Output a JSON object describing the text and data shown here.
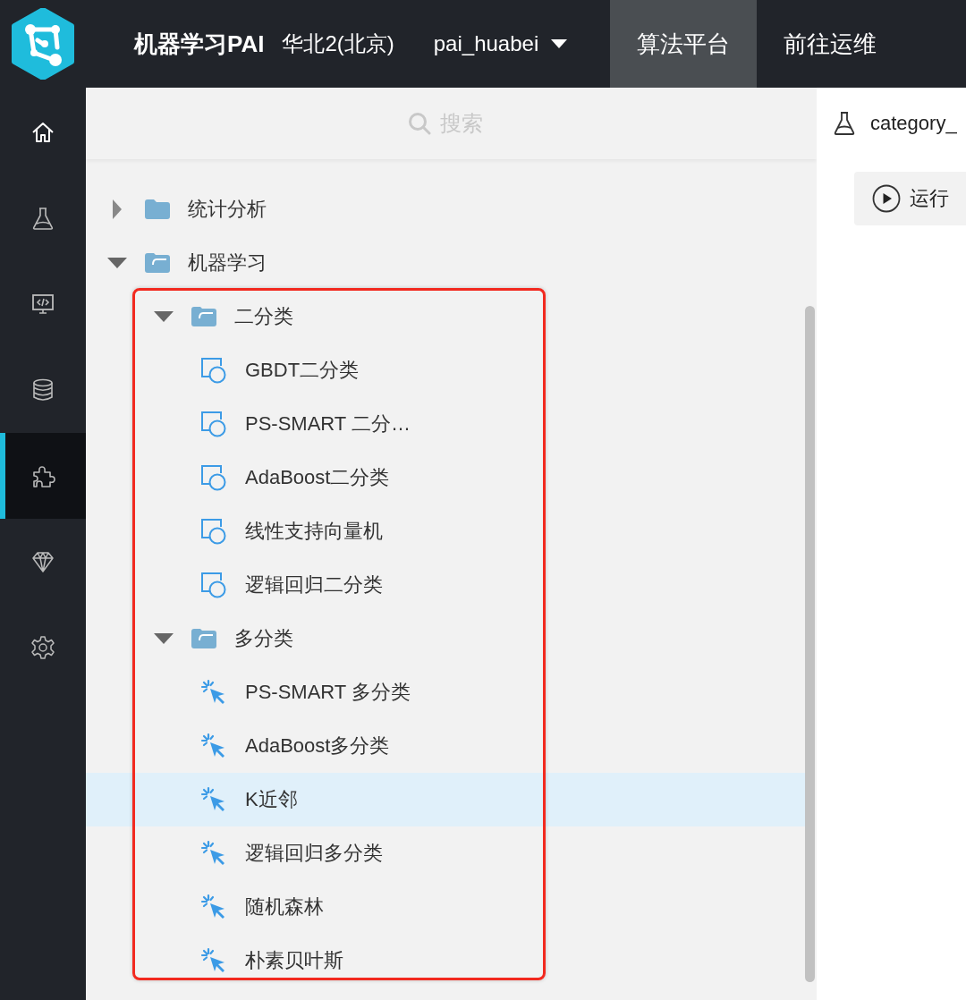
{
  "header": {
    "title": "机器学习PAI",
    "region": "华北2(北京)",
    "workspace": "pai_huabei",
    "nav": [
      {
        "label": "算法平台",
        "selected": true
      },
      {
        "label": "前往运维",
        "selected": false
      }
    ]
  },
  "sidebar": {
    "items": [
      {
        "kind": "home",
        "selected": false
      },
      {
        "kind": "flask",
        "selected": false
      },
      {
        "kind": "monitor",
        "selected": false
      },
      {
        "kind": "database",
        "selected": false
      },
      {
        "kind": "puzzle",
        "selected": true
      },
      {
        "kind": "diamond",
        "selected": false
      },
      {
        "kind": "settings",
        "selected": false
      }
    ]
  },
  "tree": {
    "search": {
      "placeholder": "搜索"
    },
    "items": [
      {
        "label": "统计分析",
        "kind": "folder",
        "expanded": false,
        "selected": false
      },
      {
        "label": "机器学习",
        "kind": "folder",
        "expanded": true,
        "selected": false,
        "children": [
          {
            "label": "二分类",
            "kind": "folder",
            "expanded": true,
            "selected": false,
            "children": [
              {
                "label": "GBDT二分类",
                "kind": "binary",
                "selected": false
              },
              {
                "label": "PS-SMART 二分…",
                "kind": "binary",
                "selected": false
              },
              {
                "label": "AdaBoost二分类",
                "kind": "binary",
                "selected": false
              },
              {
                "label": "线性支持向量机",
                "kind": "binary",
                "selected": false
              },
              {
                "label": "逻辑回归二分类",
                "kind": "binary",
                "selected": false
              }
            ]
          },
          {
            "label": "多分类",
            "kind": "folder",
            "expanded": true,
            "selected": false,
            "children": [
              {
                "label": "PS-SMART 多分类",
                "kind": "multi",
                "selected": false
              },
              {
                "label": "AdaBoost多分类",
                "kind": "multi",
                "selected": false
              },
              {
                "label": "K近邻",
                "kind": "multi",
                "selected": true
              },
              {
                "label": "逻辑回归多分类",
                "kind": "multi",
                "selected": false
              },
              {
                "label": "随机森林",
                "kind": "multi",
                "selected": false
              },
              {
                "label": "朴素贝叶斯",
                "kind": "multi",
                "selected": false
              }
            ]
          }
        ]
      }
    ]
  },
  "experiment": {
    "title": "category_",
    "run_button": "运行"
  }
}
